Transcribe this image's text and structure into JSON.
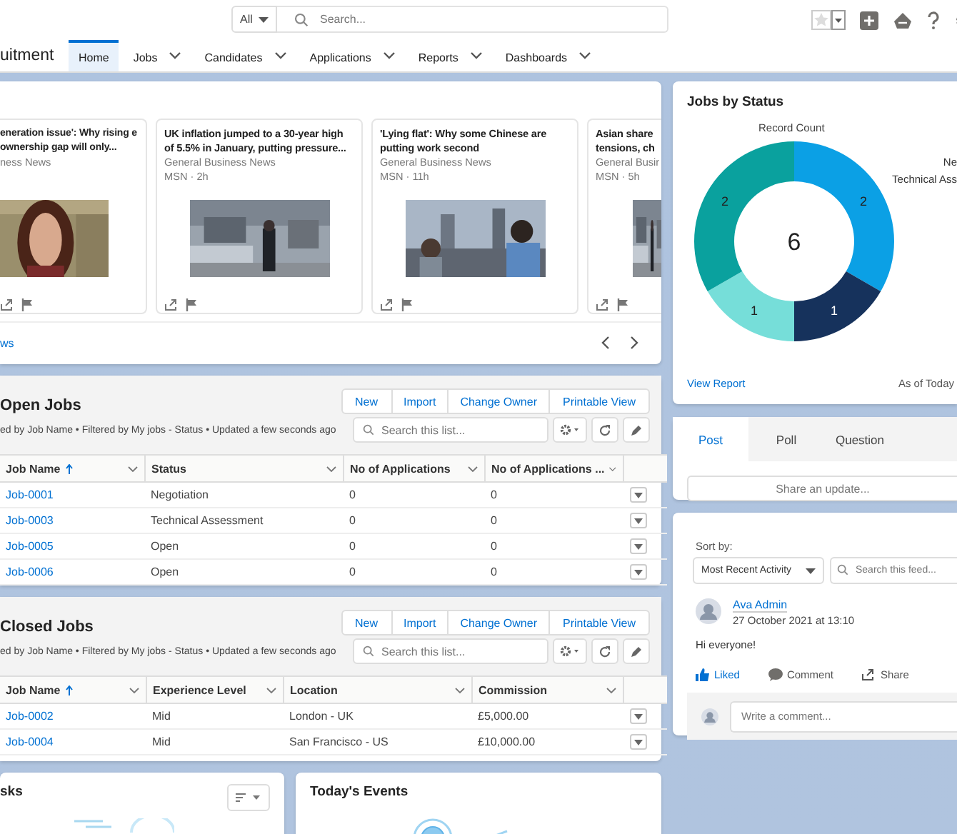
{
  "header": {
    "scope": "All",
    "search_placeholder": "Search..."
  },
  "nav": {
    "app_name": "uitment",
    "tabs": [
      {
        "label": "Home",
        "selected": true,
        "menu": false
      },
      {
        "label": "Jobs",
        "selected": false,
        "menu": true
      },
      {
        "label": "Candidates",
        "selected": false,
        "menu": true
      },
      {
        "label": "Applications",
        "selected": false,
        "menu": true
      },
      {
        "label": "Reports",
        "selected": false,
        "menu": true
      },
      {
        "label": "Dashboards",
        "selected": false,
        "menu": true
      }
    ]
  },
  "news": {
    "articles": [
      {
        "title": "eneration issue': Why rising e ownership gap will only...",
        "source": "ness News"
      },
      {
        "title": "UK inflation jumped to a 30-year high of 5.5% in January, putting pressure...",
        "source": "General Business News",
        "time": "MSN · 2h"
      },
      {
        "title": "'Lying flat': Why some Chinese are putting work second",
        "source": "General Business News",
        "time": "MSN · 11h"
      },
      {
        "title": "Asian share tensions, ch",
        "source": "General Busir",
        "time": "MSN · 5h"
      }
    ],
    "footer_link": "ws"
  },
  "lists": [
    {
      "title": "Open Jobs",
      "subtitle": "ed by Job Name • Filtered by My jobs - Status • Updated a few seconds ago",
      "buttons": [
        "New",
        "Import",
        "Change Owner",
        "Printable View"
      ],
      "search_placeholder": "Search this list...",
      "columns": [
        "Job Name",
        "Status",
        "No of Applications",
        "No of Applications ..."
      ],
      "rows": [
        [
          "Job-0001",
          "Negotiation",
          "0",
          "0"
        ],
        [
          "Job-0003",
          "Technical Assessment",
          "0",
          "0"
        ],
        [
          "Job-0005",
          "Open",
          "0",
          "0"
        ],
        [
          "Job-0006",
          "Open",
          "0",
          "0"
        ]
      ]
    },
    {
      "title": "Closed Jobs",
      "subtitle": "ed by Job Name • Filtered by My jobs - Status • Updated a few seconds ago",
      "buttons": [
        "New",
        "Import",
        "Change Owner",
        "Printable View"
      ],
      "search_placeholder": "Search this list...",
      "columns": [
        "Job Name",
        "Experience Level",
        "Location",
        "Commission"
      ],
      "rows": [
        [
          "Job-0002",
          "Mid",
          "London - UK",
          "£5,000.00"
        ],
        [
          "Job-0004",
          "Mid",
          "San Francisco - US",
          "£10,000.00"
        ]
      ]
    }
  ],
  "tasks": {
    "title": "sks"
  },
  "events": {
    "title": "Today's Events"
  },
  "jobs_by_status": {
    "title": "Jobs by Status",
    "total": "6",
    "legend": [
      "Ne",
      "Technical Ass"
    ],
    "chart_data": {
      "type": "donut",
      "title": "Record Count",
      "values": [
        2,
        1,
        1,
        2
      ],
      "data_labels": true
    },
    "view_report": "View Report",
    "as_of": "As of Today"
  },
  "publisher": {
    "tabs": [
      {
        "label": "Post",
        "selected": true
      },
      {
        "label": "Poll",
        "selected": false
      },
      {
        "label": "Question",
        "selected": false
      }
    ],
    "share": "Share an update..."
  },
  "feed": {
    "sort_label": "Sort by:",
    "sort_value": "Most Recent Activity",
    "search_placeholder": "Search this feed...",
    "post": {
      "author": "Ava Admin",
      "date": "27 October 2021 at 13:10",
      "body": "Hi everyone!",
      "actions": [
        {
          "label": "Liked",
          "kind": "like",
          "selected": true
        },
        {
          "label": "Comment",
          "kind": "comment",
          "selected": false
        },
        {
          "label": "Share",
          "kind": "share",
          "selected": false
        }
      ],
      "comment_placeholder": "Write a comment..."
    }
  }
}
